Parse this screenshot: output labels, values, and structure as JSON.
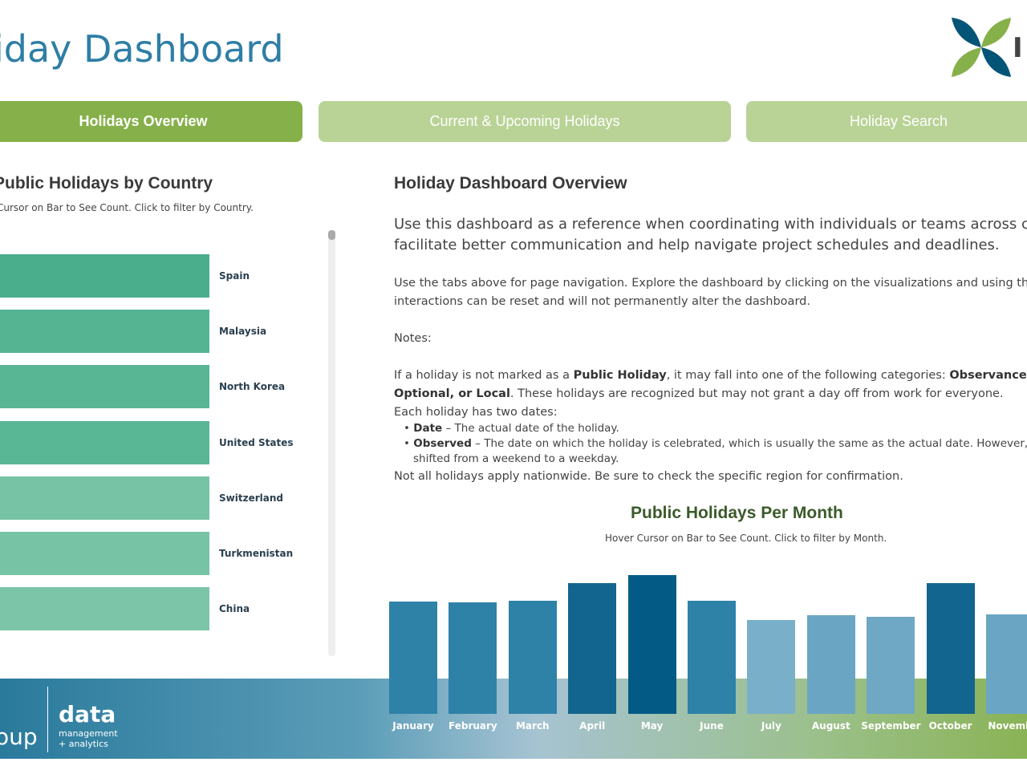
{
  "header": {
    "title": "iday Dashboard",
    "logo_text": "I"
  },
  "tabs": [
    {
      "label": "Holidays Overview",
      "active": true
    },
    {
      "label": "Current & Upcoming Holidays"
    },
    {
      "label": "Holiday Search"
    }
  ],
  "left": {
    "title": "Public Holidays by Country",
    "subtitle": "Cursor on Bar to See Count. Click to filter by Country.",
    "countries": [
      {
        "name": "Spain",
        "rel": 1.0,
        "color": "#4aae8c"
      },
      {
        "name": "Malaysia",
        "rel": 1.0,
        "color": "#55b592"
      },
      {
        "name": "North Korea",
        "rel": 1.0,
        "color": "#58b694"
      },
      {
        "name": "United States",
        "rel": 1.0,
        "color": "#5ab796"
      },
      {
        "name": "Switzerland",
        "rel": 0.97,
        "color": "#77c3a6"
      },
      {
        "name": "Turkmenistan",
        "rel": 0.97,
        "color": "#77c3a6"
      },
      {
        "name": "China",
        "rel": 0.94,
        "color": "#7cc5a9"
      }
    ]
  },
  "overview": {
    "title": "Holiday Dashboard Overview",
    "intro1": "Use this dashboard as a reference when coordinating with individuals or teams across cou",
    "intro2": "facilitate better communication and help navigate project schedules and deadlines.",
    "nav1": "Use the tabs above for page navigation. Explore the dashboard by clicking on the visualizations and using the",
    "nav2": "interactions can be reset and will not permanently alter the dashboard.",
    "notes": "Notes:",
    "p1a": "If a holiday is not marked as a ",
    "p1b": "Public Holiday",
    "p1c": ", it may fall into one of the following categories: ",
    "p1d": "Observance, Re",
    "p2a": "Optional, or Local",
    "p2b": ". These holidays are recognized but may not grant a day off from work for everyone.",
    "p3": "Each holiday has two dates:",
    "b1a": "Date",
    "b1b": " – The actual date of the holiday.",
    "b2a": "Observed",
    "b2b": " – The date on which the holiday is celebrated, which is usually the same as the actual date. However, som",
    "b2c": "shifted from a weekend to a weekday.",
    "p4": "Not all holidays apply nationwide. Be sure to check the specific region for confirmation."
  },
  "chart_data": {
    "type": "bar",
    "title": "Public Holidays Per Month",
    "subtitle": "Hover Cursor on Bar to See Count. Click to filter by Month.",
    "categories": [
      "January",
      "February",
      "March",
      "April",
      "May",
      "June",
      "July",
      "August",
      "September",
      "October",
      "Novemb"
    ],
    "values": [
      140,
      139,
      141,
      163,
      173,
      141,
      117,
      123,
      121,
      163,
      124
    ],
    "colors": [
      "#2e82a8",
      "#2e82a8",
      "#2e82a8",
      "#12658e",
      "#035a85",
      "#2e82a8",
      "#7aafc9",
      "#6aa6c4",
      "#6ea8c5",
      "#12658e",
      "#6aa6c4"
    ]
  },
  "footer": {
    "brand_left": "oup",
    "brand_main": "data",
    "brand_sub1": "management",
    "brand_sub2": "+ analytics"
  }
}
